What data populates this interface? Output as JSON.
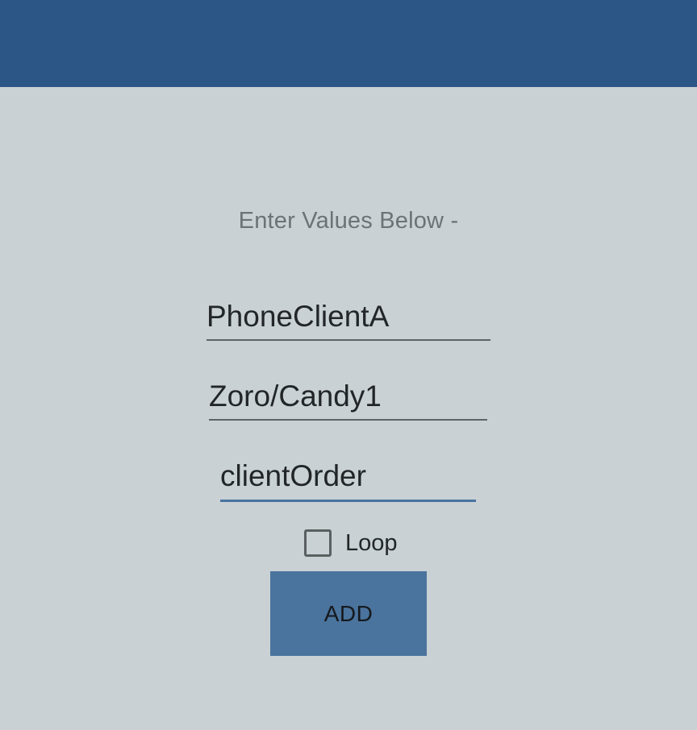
{
  "app_bar": {
    "title": ""
  },
  "form": {
    "instruction": "Enter Values Below -",
    "fields": [
      {
        "value": "PhoneClientA"
      },
      {
        "value": "Zoro/Candy1"
      },
      {
        "value": "clientOrder"
      }
    ],
    "loop": {
      "label": "Loop",
      "checked": false
    },
    "add_label": "ADD"
  },
  "colors": {
    "app_bar": "#2b5685",
    "background": "#c9d1d4",
    "button": "#4a739d",
    "focused_underline": "#4a73a2"
  }
}
